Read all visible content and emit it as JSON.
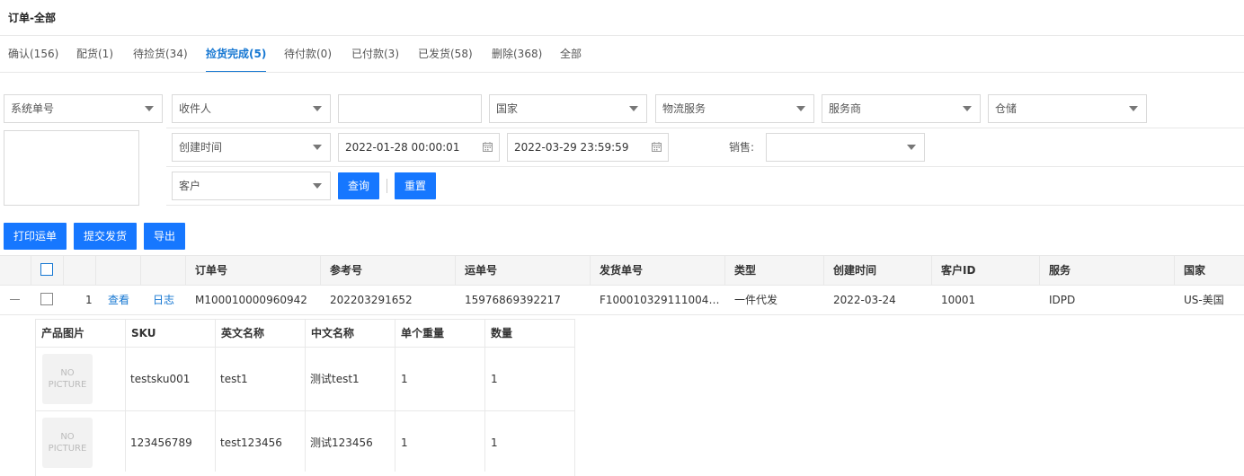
{
  "page_title": "订单-全部",
  "tabs": [
    {
      "label": "确认(156)"
    },
    {
      "label": "配货(1)"
    },
    {
      "label": "待捡货(34)"
    },
    {
      "label": "捡货完成(5)"
    },
    {
      "label": "待付款(0)"
    },
    {
      "label": "已付款(3)"
    },
    {
      "label": "已发货(58)"
    },
    {
      "label": "删除(368)"
    },
    {
      "label": "全部"
    }
  ],
  "filters": {
    "system_no": "系统单号",
    "receiver": "收件人",
    "keyword_value": "",
    "country": "国家",
    "logistics": "物流服务",
    "provider": "服务商",
    "warehouse": "仓储",
    "time_type": "创建时间",
    "start_time": "2022-01-28 00:00:01",
    "end_time": "2022-03-29 23:59:59",
    "sales_label": "销售:",
    "sales_value": "",
    "customer": "客户",
    "query_label": "查询",
    "reset_label": "重置"
  },
  "actions": {
    "print": "打印运单",
    "submit": "提交发货",
    "export": "导出"
  },
  "table": {
    "headers": [
      "订单号",
      "参考号",
      "运单号",
      "发货单号",
      "类型",
      "创建时间",
      "客户ID",
      "服务",
      "国家"
    ],
    "row": {
      "index": "1",
      "view": "查看",
      "log": "日志",
      "order_no": "M100010000960942",
      "ref_no": "202203291652",
      "waybill_no": "15976869392217",
      "ship_no": "F1000103291110049…",
      "type": "一件代发",
      "created": "2022-03-24",
      "customer_id": "10001",
      "service": "IDPD",
      "country": "US-美国"
    }
  },
  "products": {
    "headers": [
      "产品图片",
      "SKU",
      "英文名称",
      "中文名称",
      "单个重量",
      "数量"
    ],
    "no_picture": [
      "NO",
      "PICTURE"
    ],
    "rows": [
      {
        "sku": "testsku001",
        "en": "test1",
        "cn": "测试test1",
        "weight": "1",
        "qty": "1"
      },
      {
        "sku": "123456789",
        "en": "test123456",
        "cn": "测试123456",
        "weight": "1",
        "qty": "1"
      }
    ]
  },
  "colors": {
    "accent": "#1677ff",
    "link": "#1677d2"
  }
}
